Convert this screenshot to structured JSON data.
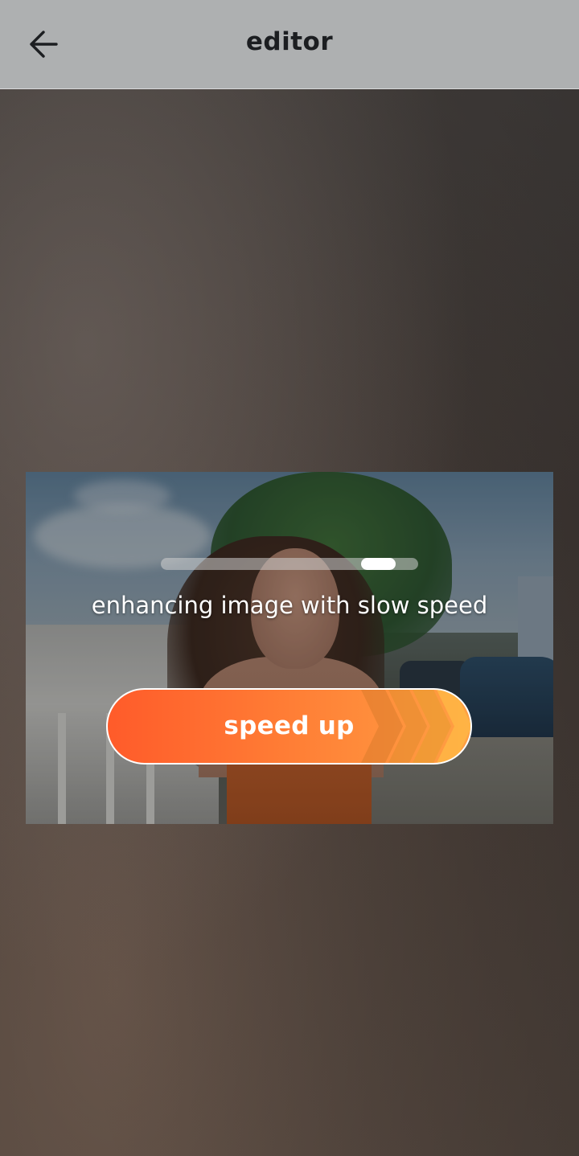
{
  "header": {
    "title": "editor",
    "back_icon": "arrow-left-icon"
  },
  "enhance": {
    "progress": 0.9,
    "status_text": "enhancing image with slow speed",
    "speed_up_label": "speed up"
  },
  "colors": {
    "accent_start": "#ff5b2a",
    "accent_end": "#ffa043",
    "header_bg": "#aeb0b1"
  }
}
